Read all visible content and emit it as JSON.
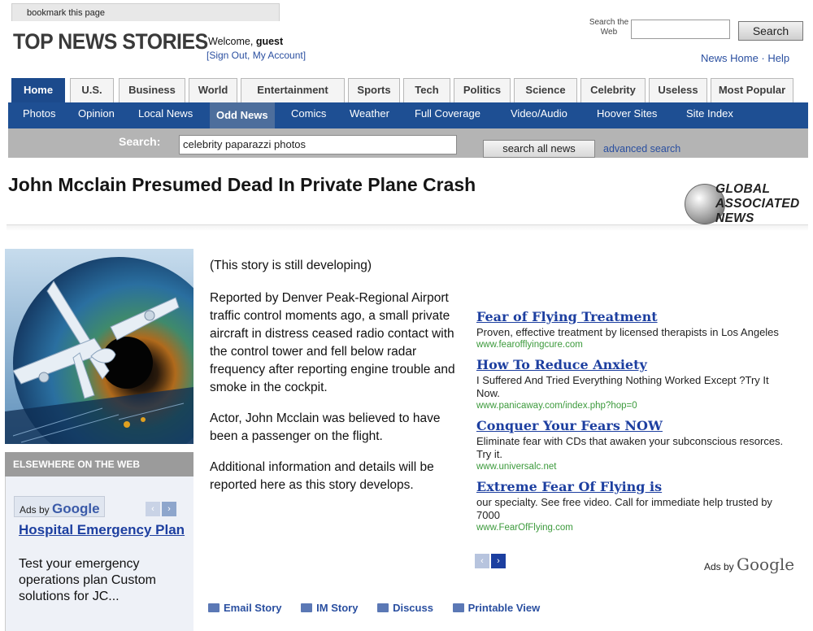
{
  "bookmark": "bookmark this page",
  "site": {
    "logo": "TOP NEWS STORIES",
    "welcome_prefix": "Welcome, ",
    "user": "guest",
    "account_links": "[Sign Out, My Account]",
    "search_web_label": "Search the Web",
    "search_web_button": "Search",
    "top_links": "News Home · Help"
  },
  "tabs": [
    "Home",
    "U.S.",
    "Business",
    "World",
    "Entertainment",
    "Sports",
    "Tech",
    "Politics",
    "Science",
    "Celebrity",
    "Useless",
    "Most Popular"
  ],
  "subnav": [
    "Photos",
    "Opinion",
    "Local News",
    "Odd News",
    "Comics",
    "Weather",
    "Full Coverage",
    "Video/Audio",
    "Hoover Sites",
    "Site Index"
  ],
  "search": {
    "label": "Search:",
    "value": "celebrity paparazzi photos",
    "button": "search all news",
    "advanced": "advanced search"
  },
  "article": {
    "headline": "John Mcclain Presumed Dead In Private Plane Crash",
    "source": [
      "GLOBAL",
      "ASSOCIATED",
      "NEWS"
    ],
    "paragraphs": [
      "(This story is still developing)",
      "Reported by Denver Peak-Regional Airport traffic control moments ago, a small private aircraft in distress ceased radio contact with the control tower and fell below radar frequency after reporting engine trouble and smoke in the cockpit.",
      "Actor, John Mcclain was believed to have been a passenger on the flight.",
      "Additional information and details will be reported here as this story develops."
    ]
  },
  "elsewhere": {
    "heading": "ELSEWHERE ON THE WEB",
    "ads_by": "Ads by ",
    "google": "Google",
    "ad_title": "Hospital Emergency Plan",
    "ad_desc": "Test your emergency operations plan Custom solutions for JC..."
  },
  "ads": [
    {
      "title": "Fear of Flying Treatment",
      "body": "Proven, effective treatment by licensed therapists in Los Angeles",
      "url": "www.fearofflyingcure.com"
    },
    {
      "title": "How To Reduce Anxiety",
      "body": "I Suffered And Tried Everything Nothing Worked Except ?Try It Now.",
      "url": "www.panicaway.com/index.php?hop=0"
    },
    {
      "title": "Conquer Your Fears NOW",
      "body": "Eliminate fear with CDs that awaken your subconscious resorces. Try it.",
      "url": "www.universalc.net"
    },
    {
      "title": "Extreme Fear Of Flying is",
      "body": "our specialty. See free video. Call for immediate help trusted by 7000",
      "url": "www.FearOfFlying.com"
    }
  ],
  "ads_footer": {
    "ads_by": "Ads by ",
    "google": "Google"
  },
  "actions": [
    "Email Story",
    "IM Story",
    "Discuss",
    "Printable View"
  ],
  "icons": {
    "arrow_left": "‹",
    "arrow_right": "›"
  }
}
